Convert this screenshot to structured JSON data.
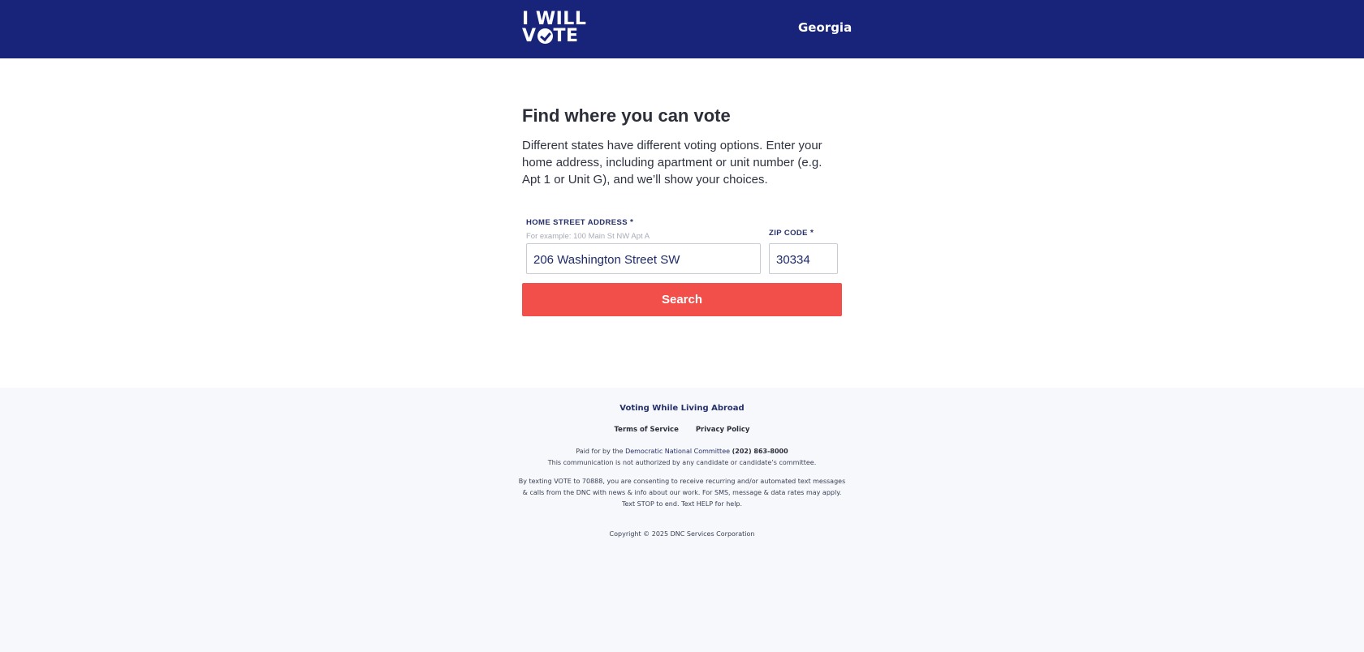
{
  "header": {
    "logo_line1": "I WILL",
    "logo_line2_before": "V",
    "logo_line2_after": "TE",
    "state": "Georgia"
  },
  "main": {
    "title": "Find where you can vote",
    "description": "Different states have different voting options. Enter your home address, including apartment or unit number (e.g. Apt 1 or Unit G), and we’ll show your choices."
  },
  "form": {
    "address_label": "HOME STREET ADDRESS",
    "address_required": "*",
    "address_hint": "For example: 100 Main St NW Apt A",
    "address_value": "206 Washington Street SW",
    "zip_label": "ZIP CODE",
    "zip_required": "*",
    "zip_value": "30334",
    "search_label": "Search"
  },
  "footer": {
    "abroad_link": "Voting While Living Abroad",
    "terms_link": "Terms of Service",
    "privacy_link": "Privacy Policy",
    "paid_prefix": "Paid for by the",
    "paid_org": "Democratic National Committee",
    "paid_phone": "(202) 863-8000",
    "not_authorized": "This communication is not authorized by any candidate or candidate’s committee.",
    "sms_line1": "By texting VOTE to 70888, you are consenting to receive recurring and/or automated text messages",
    "sms_line2": "& calls from the DNC with news & info about our work. For SMS, message & data rates may apply.",
    "sms_line3": "Text STOP to end. Text HELP for help.",
    "copyright": "Copyright © 2025 DNC Services Corporation"
  },
  "colors": {
    "header_bg": "#182479",
    "button_bg": "#f24e4a",
    "footer_bg": "#f6f8fc"
  }
}
